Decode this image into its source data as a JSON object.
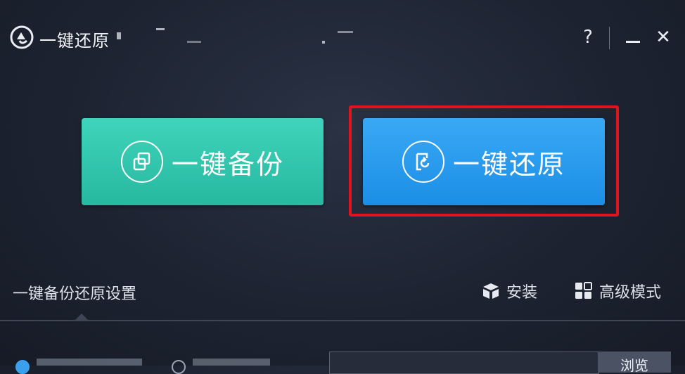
{
  "window": {
    "title": "一键还原",
    "help_label": "?",
    "close_label": "✕"
  },
  "actions": {
    "backup_label": "一键备份",
    "restore_label": "一键还原"
  },
  "settings": {
    "section_label": "一键备份还原设置",
    "install_label": "安装",
    "advanced_label": "高级模式"
  },
  "bottom": {
    "browse_label": "浏览"
  },
  "colors": {
    "backup": "#2fc4aa",
    "restore": "#2a9cee",
    "highlight": "#e0141f",
    "background": "#1d2331"
  },
  "icons": {
    "app": "app-logo-icon",
    "backup": "copy-squares-icon",
    "restore": "restore-arrow-icon",
    "install": "box-icon",
    "advanced": "grid-icon"
  }
}
